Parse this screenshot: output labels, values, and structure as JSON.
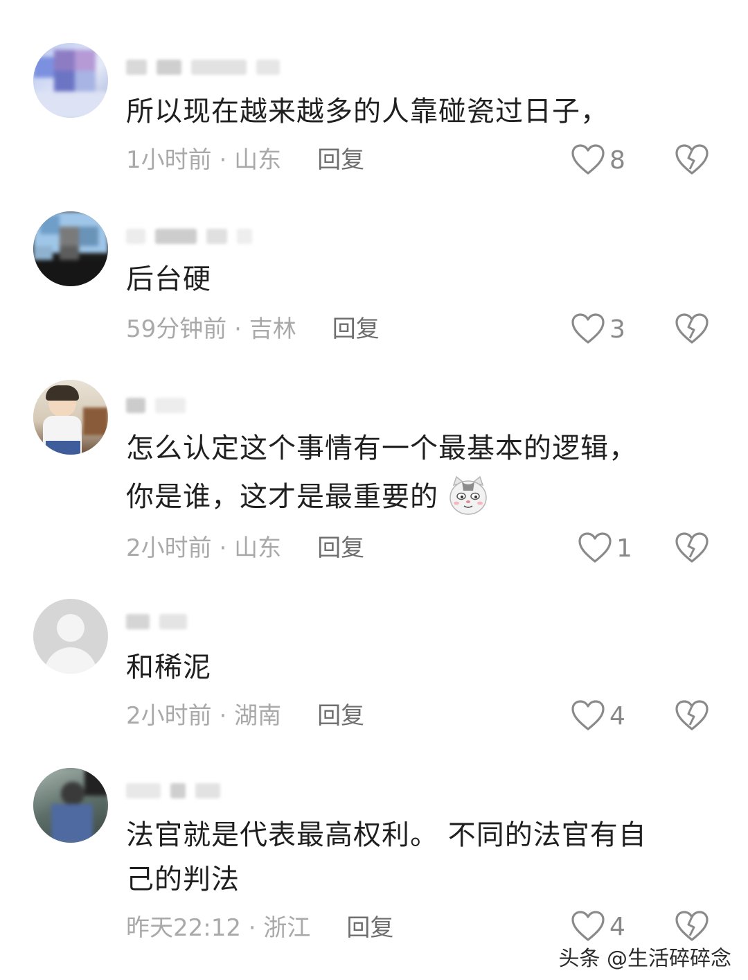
{
  "comments": [
    {
      "text": "所以现在越来越多的人靠碰瓷过日子，",
      "time": "1小时前",
      "separator": " · ",
      "location": "山东",
      "reply": "回复",
      "likes": "8"
    },
    {
      "text": "后台硬",
      "time": "59分钟前",
      "separator": " · ",
      "location": "吉林",
      "reply": "回复",
      "likes": "3"
    },
    {
      "text_line1": "怎么认定这个事情有一个最基本的逻辑，",
      "text_line2": "你是谁，这才是最重要的",
      "emoji": "cat-face-emoji",
      "time": "2小时前",
      "separator": " · ",
      "location": "山东",
      "reply": "回复",
      "likes": "1"
    },
    {
      "text": "和稀泥",
      "time": "2小时前",
      "separator": " · ",
      "location": "湖南",
      "reply": "回复",
      "likes": "4"
    },
    {
      "text_line1": "法官就是代表最高权利。 不同的法官有自",
      "text_line2": "己的判法",
      "time": "昨天22:12",
      "separator": " · ",
      "location": "浙江",
      "reply": "回复",
      "likes": "4"
    }
  ],
  "watermark": "头条 @生活碎碎念",
  "colors": {
    "text": "#1f1f1f",
    "meta": "#a9a9a9",
    "reply": "#6e6e6e",
    "icon": "#8a8a8a"
  },
  "icons": [
    "heart-outline-icon",
    "broken-heart-icon"
  ]
}
